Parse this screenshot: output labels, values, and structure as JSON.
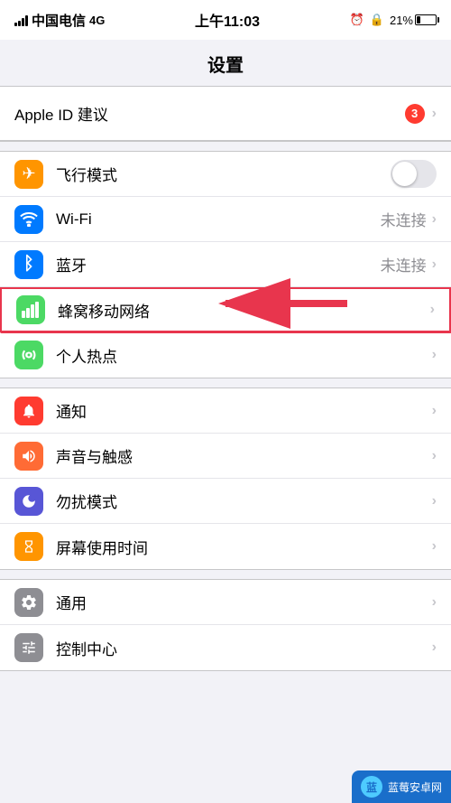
{
  "statusBar": {
    "carrier": "中国电信",
    "networkType": "4G",
    "time": "上午11:03",
    "batteryPercent": "21%"
  },
  "header": {
    "title": "设置"
  },
  "appleId": {
    "title": "Apple ID 建议",
    "badge": "3"
  },
  "section1": {
    "items": [
      {
        "id": "airplane",
        "label": "飞行模式",
        "iconColor": "orange",
        "iconSymbol": "✈",
        "hasToggle": true,
        "toggleOn": false
      },
      {
        "id": "wifi",
        "label": "Wi-Fi",
        "iconColor": "blue",
        "iconSymbol": "wifi",
        "value": "未连接",
        "hasChevron": true
      },
      {
        "id": "bluetooth",
        "label": "蓝牙",
        "iconColor": "blue-dark",
        "iconSymbol": "bt",
        "value": "未连接",
        "hasChevron": true
      },
      {
        "id": "cellular",
        "label": "蜂窝移动网络",
        "iconColor": "green-cellular",
        "iconSymbol": "cellular",
        "hasChevron": true,
        "highlighted": true
      },
      {
        "id": "hotspot",
        "label": "个人热点",
        "iconColor": "green",
        "iconSymbol": "hotspot",
        "hasChevron": true
      }
    ]
  },
  "section2": {
    "items": [
      {
        "id": "notification",
        "label": "通知",
        "iconColor": "red",
        "iconSymbol": "notif",
        "hasChevron": true
      },
      {
        "id": "sound",
        "label": "声音与触感",
        "iconColor": "orange-sound",
        "iconSymbol": "sound",
        "hasChevron": true
      },
      {
        "id": "dnd",
        "label": "勿扰模式",
        "iconColor": "indigo",
        "iconSymbol": "moon",
        "hasChevron": true
      },
      {
        "id": "screentime",
        "label": "屏幕使用时间",
        "iconColor": "purple",
        "iconSymbol": "hourglass",
        "hasChevron": true
      }
    ]
  },
  "section3": {
    "items": [
      {
        "id": "general",
        "label": "通用",
        "iconColor": "gray",
        "iconSymbol": "gear",
        "hasChevron": true
      },
      {
        "id": "controlcenter",
        "label": "控制中心",
        "iconColor": "gray",
        "iconSymbol": "sliders",
        "hasChevron": true
      }
    ]
  },
  "watermark": {
    "text": "蓝莓安卓网",
    "logoText": "蓝"
  },
  "annotation": {
    "arrowText": "→"
  }
}
